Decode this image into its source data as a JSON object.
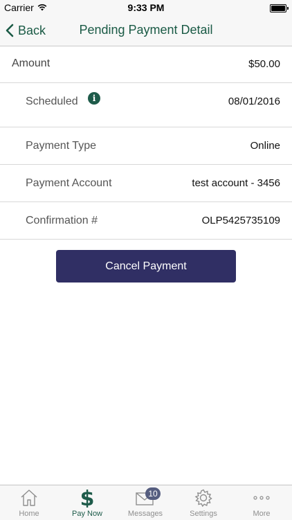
{
  "status_bar": {
    "carrier": "Carrier",
    "time": "9:33 PM"
  },
  "nav": {
    "back_label": "Back",
    "title": "Pending Payment Detail"
  },
  "rows": [
    {
      "label": "Amount",
      "value": "$50.00"
    },
    {
      "label": "Scheduled",
      "value": "08/01/2016",
      "info_icon": "i"
    },
    {
      "label": "Payment Type",
      "value": "Online"
    },
    {
      "label": "Payment Account",
      "value": "test account - 3456"
    },
    {
      "label": "Confirmation #",
      "value": "OLP5425735109"
    }
  ],
  "cancel_button": {
    "label": "Cancel Payment"
  },
  "tabs": [
    {
      "label": "Home",
      "icon": "home-icon",
      "active": false
    },
    {
      "label": "Pay Now",
      "icon": "dollar-icon",
      "active": true
    },
    {
      "label": "Messages",
      "icon": "envelope-icon",
      "active": false,
      "badge": "10"
    },
    {
      "label": "Settings",
      "icon": "gear-icon",
      "active": false
    },
    {
      "label": "More",
      "icon": "more-icon",
      "active": false
    }
  ],
  "colors": {
    "accent": "#1e5b4a",
    "button": "#302f64",
    "badge": "#555d7f"
  }
}
